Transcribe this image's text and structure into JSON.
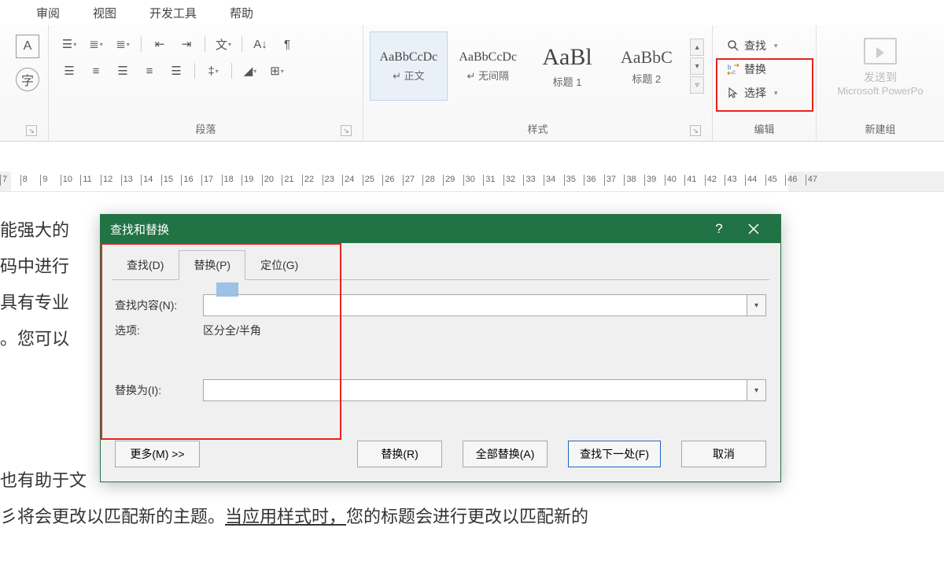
{
  "ribbon_tabs": {
    "review": "审阅",
    "view": "视图",
    "dev": "开发工具",
    "help": "帮助"
  },
  "font_group": {
    "box1": "A",
    "box2": "字"
  },
  "para_group": {
    "label": "段落"
  },
  "styles_group": {
    "label": "样式",
    "tiles": [
      {
        "sample": "AaBbCcDc",
        "name": "↵ 正文"
      },
      {
        "sample": "AaBbCcDc",
        "name": "↵ 无间隔"
      },
      {
        "sample": "AaBl",
        "name": "标题 1"
      },
      {
        "sample": "AaBbC",
        "name": "标题 2"
      }
    ]
  },
  "edit_group": {
    "label": "编辑",
    "find": "查找",
    "replace": "替换",
    "select": "选择"
  },
  "new_group": {
    "label": "新建组",
    "sendto": "发送到",
    "target": "Microsoft PowerPo"
  },
  "ruler_start": 7,
  "ruler_end": 47,
  "doc_lines": {
    "l1": "能强大的",
    "l2": "码中进行",
    "l3": "具有专业",
    "l4": "。您可以"
  },
  "dialog": {
    "title": "查找和替换",
    "tabs": {
      "find": "查找(D)",
      "replace": "替换(P)",
      "goto": "定位(G)"
    },
    "labels": {
      "findwhat": "查找内容(N):",
      "options": "选项:",
      "opts_val": "区分全/半角",
      "replacewith": "替换为(I):"
    },
    "buttons": {
      "more": "更多(M) >>",
      "replace": "替换(R)",
      "replaceall": "全部替换(A)",
      "findnext": "查找下一处(F)",
      "cancel": "取消"
    }
  },
  "bottom": {
    "l1": "也有助于文",
    "l2a": "彡将会更改以匹配新的主题。",
    "l2b": "当应用样式时，",
    "l2c": "您的标题会进行更改以匹配新的"
  }
}
